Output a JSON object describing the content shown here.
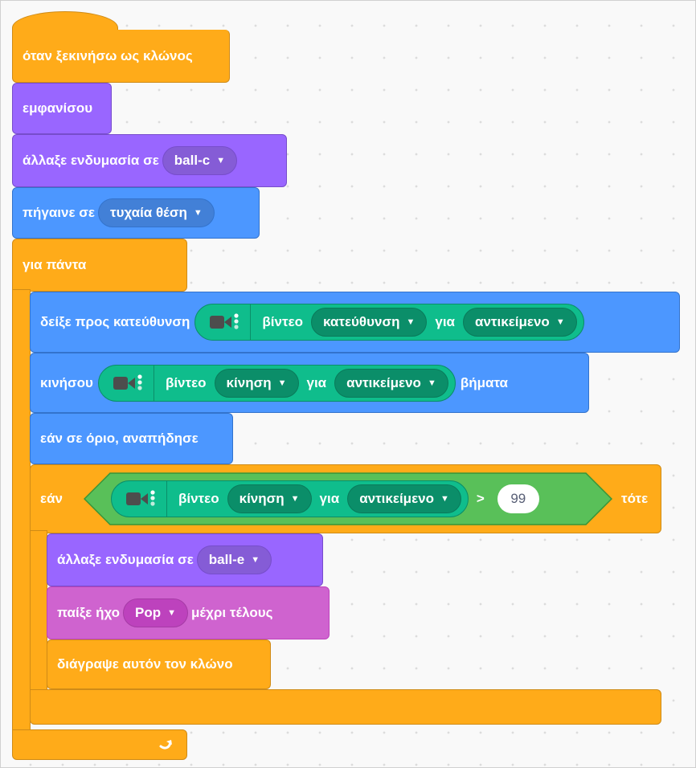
{
  "blocks": {
    "hat": "όταν ξεκινήσω ως κλώνος",
    "show": "εμφανίσου",
    "switch_costume": {
      "label": "άλλαξε ενδυμασία σε",
      "value": "ball-c"
    },
    "go_to": {
      "label": "πήγαινε σε",
      "value": "τυχαία θέση"
    },
    "forever": {
      "label": "για πάντα"
    },
    "point": {
      "label": "δείξε προς κατεύθυνση",
      "video": "βίντεο",
      "attr": "κατεύθυνση",
      "on": "για",
      "target": "αντικείμενο"
    },
    "move": {
      "label": "κινήσου",
      "video": "βίντεο",
      "attr": "κίνηση",
      "on": "για",
      "target": "αντικείμενο",
      "suffix": "βήματα"
    },
    "bounce": "εάν σε όριο, αναπήδησε",
    "if_block": {
      "if": "εάν",
      "video": "βίντεο",
      "attr": "κίνηση",
      "on": "για",
      "target": "αντικείμενο",
      "op": ">",
      "value": "99",
      "then": "τότε"
    },
    "switch_costume_2": {
      "label": "άλλαξε ενδυμασία σε",
      "value": "ball-e"
    },
    "play_sound": {
      "label": "παίξε ήχο",
      "value": "Pop",
      "suffix": "μέχρι τέλους"
    },
    "delete_clone": "διάγραψε αυτόν τον κλώνο"
  },
  "colors": {
    "events": "#ffab19",
    "looks": "#9966ff",
    "motion": "#4c97ff",
    "control": "#ffab19",
    "sound": "#cf63cf",
    "operators": "#59c059",
    "video_extension": "#0fbd8c"
  },
  "icons": {
    "video": "video-camera-icon",
    "dropdown": "caret-down-icon",
    "loop": "loop-arrow-icon"
  }
}
